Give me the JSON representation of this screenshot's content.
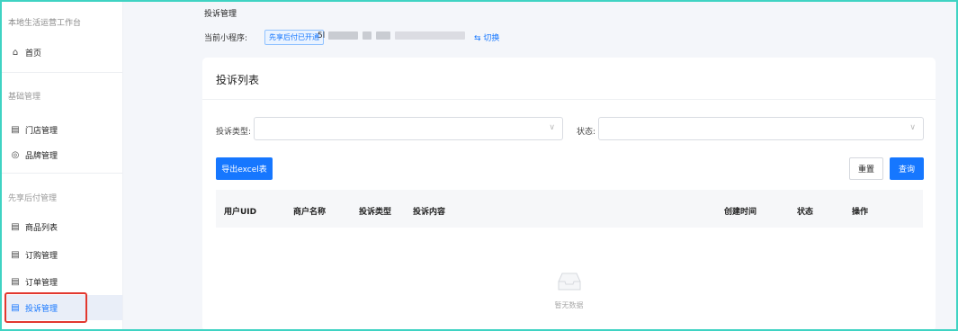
{
  "sidebar": {
    "title": "本地生活运营工作台",
    "home": "首页",
    "group1": "基础管理",
    "store_mgmt": "门店管理",
    "brand_mgmt": "品牌管理",
    "group2": "先享后付管理",
    "product_list": "商品列表",
    "subscription_mgmt": "订购管理",
    "order_mgmt": "订单管理",
    "complaint_mgmt": "投诉管理"
  },
  "header": {
    "breadcrumb": "投诉管理",
    "mini_program_label": "当前小程序:",
    "status_badge": "先享后付已开通",
    "app_id_prefix": "5l",
    "switch_label": "⇆ 切换"
  },
  "card": {
    "title": "投诉列表",
    "complaint_type_label": "投诉类型:",
    "status_label": "状态:",
    "export_button": "导出excel表",
    "reset_button": "重置",
    "query_button": "查询"
  },
  "table": {
    "columns": [
      "用户UID",
      "商户名称",
      "投诉类型",
      "投诉内容",
      "创建时间",
      "状态",
      "操作"
    ],
    "empty_text": "暂无数据"
  },
  "icons": {
    "home": "home-icon",
    "store": "store-icon",
    "brand": "location-pin-icon",
    "doc": "document-icon"
  },
  "colors": {
    "accent": "#1677ff",
    "highlight_box": "#e2382f",
    "frame": "#3fd3c3"
  }
}
